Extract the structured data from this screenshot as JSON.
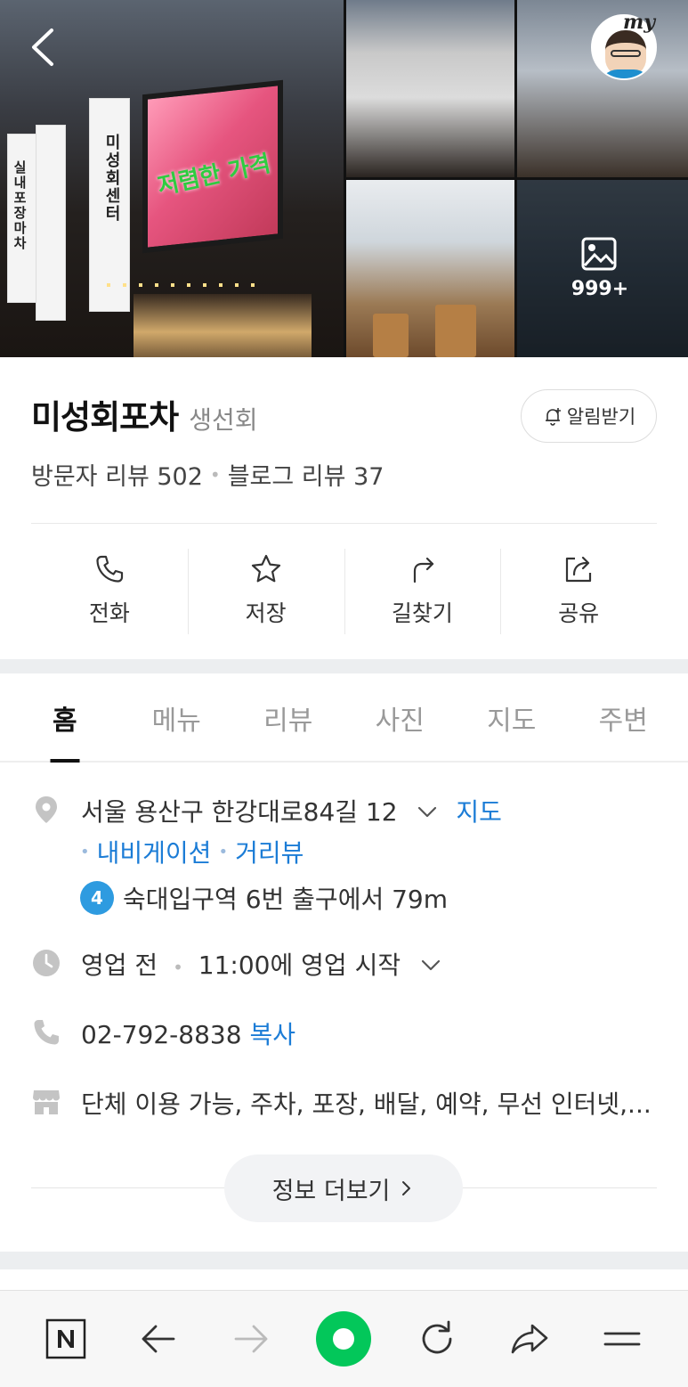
{
  "header": {
    "my_label": "my",
    "photo_count": "999+"
  },
  "place": {
    "name": "미성회포차",
    "category": "생선회",
    "notify_label": "알림받기",
    "visitor_reviews": "방문자 리뷰 502",
    "blog_reviews": "블로그 리뷰 37"
  },
  "actions": [
    {
      "label": "전화",
      "icon": "phone-icon"
    },
    {
      "label": "저장",
      "icon": "star-icon"
    },
    {
      "label": "길찾기",
      "icon": "directions-icon"
    },
    {
      "label": "공유",
      "icon": "share-icon"
    }
  ],
  "tabs": [
    {
      "label": "홈",
      "active": true
    },
    {
      "label": "메뉴"
    },
    {
      "label": "리뷰"
    },
    {
      "label": "사진"
    },
    {
      "label": "지도"
    },
    {
      "label": "주변"
    }
  ],
  "details": {
    "address": "서울 용산구 한강대로84길 12",
    "map_link": "지도",
    "navigation_link": "내비게이션",
    "streetview_link": "거리뷰",
    "subway_line": "4",
    "subway_text": "숙대입구역 6번 출구에서 79m",
    "hours_status": "영업 전",
    "hours_text": "11:00에 영업 시작",
    "phone": "02-792-8838",
    "copy_label": "복사",
    "facilities": "단체 이용 가능, 주차, 포장, 배달, 예약, 무선 인터넷,...",
    "more_info_label": "정보 더보기"
  },
  "photo_text": {
    "main_sign": "저렴한 가격",
    "banner_left": "실내포장마차",
    "banner_right": "미성회센터"
  },
  "colors": {
    "link": "#1b7cd6",
    "naver_green": "#03c75a",
    "subway_line_4": "#2e9be0"
  }
}
